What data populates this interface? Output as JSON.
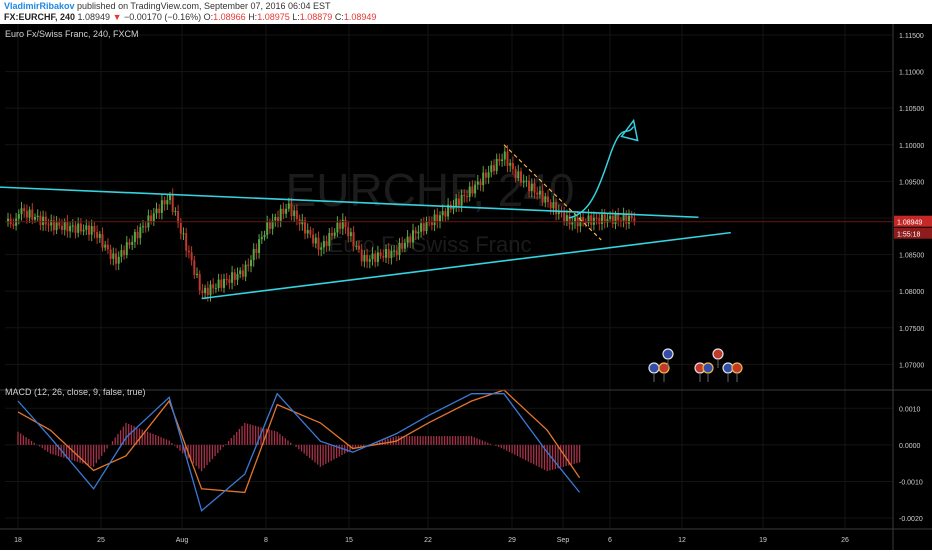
{
  "header": {
    "user": "VladimirRibakov",
    "published": " published on TradingView.com, September 07, 2016 06:04 EST",
    "symbol": "FX:EURCHF, 240",
    "last": "1.08949",
    "arrow": "▼",
    "change": "−0.00170 (−0.16%)",
    "o_label": "O:",
    "o": "1.08966",
    "h_label": "H:",
    "h": "1.08975",
    "l_label": "L:",
    "l": "1.08879",
    "c_label": "C:",
    "c": "1.08949"
  },
  "main_pane": {
    "title": "Euro Fx/Swiss Franc, 240, FXCM",
    "watermark_symbol": "EURCHF, 240",
    "watermark_desc": "Euro Fx/Swiss Franc",
    "price_tag": "1.08949",
    "countdown_tag": "1:55:18"
  },
  "macd_pane": {
    "title": "MACD (12, 26, close, 9, false, true)"
  },
  "colors": {
    "background": "#000000",
    "up_candle": "#5aa845",
    "down_candle": "#c0392b",
    "trendline": "#35d2e0",
    "dashed": "#f0b847",
    "macd_line": "#3a7ad6",
    "signal_line": "#e3752c",
    "histogram": "#a8324a",
    "price_tag": "#c62828",
    "axis_text": "#cfcfcf"
  },
  "chart_data": [
    {
      "type": "candlestick",
      "title": "Euro Fx/Swiss Franc, 240, FXCM",
      "y_axis_ticks": [
        "1.11500",
        "1.11000",
        "1.10500",
        "1.10000",
        "1.09500",
        "1.09000",
        "1.08500",
        "1.08000",
        "1.07500",
        "1.07000"
      ],
      "x_axis_ticks": [
        "18",
        "25",
        "Aug",
        "8",
        "15",
        "22",
        "29",
        "Sep",
        "6",
        "12",
        "19",
        "26"
      ],
      "ylim": [
        1.0665,
        1.1165
      ],
      "last_price": 1.08949,
      "swing_points": [
        {
          "x": "Jul 18",
          "y": 1.0915
        },
        {
          "x": "Jul 21",
          "y": 1.0895
        },
        {
          "x": "Jul 25",
          "y": 1.0885
        },
        {
          "x": "Jul 27",
          "y": 1.084
        },
        {
          "x": "Jul 29",
          "y": 1.0875
        },
        {
          "x": "Aug 1",
          "y": 1.0925
        },
        {
          "x": "Aug 3",
          "y": 1.084
        },
        {
          "x": "Aug 4",
          "y": 1.0795
        },
        {
          "x": "Aug 8",
          "y": 1.083
        },
        {
          "x": "Aug 10",
          "y": 1.089
        },
        {
          "x": "Aug 12",
          "y": 1.092
        },
        {
          "x": "Aug 15",
          "y": 1.086
        },
        {
          "x": "Aug 17",
          "y": 1.0895
        },
        {
          "x": "Aug 19",
          "y": 1.084
        },
        {
          "x": "Aug 22",
          "y": 1.085
        },
        {
          "x": "Aug 24",
          "y": 1.088
        },
        {
          "x": "Aug 26",
          "y": 1.09
        },
        {
          "x": "Aug 29",
          "y": 1.094
        },
        {
          "x": "Sep 1",
          "y": 1.099
        },
        {
          "x": "Sep 2",
          "y": 1.0965
        },
        {
          "x": "Sep 5",
          "y": 1.0925
        },
        {
          "x": "Sep 7",
          "y": 1.0895
        }
      ],
      "annotations": [
        {
          "kind": "trendline",
          "from": {
            "x": "Jul 15",
            "y": 1.0943
          },
          "to": {
            "x": "Sep 19",
            "y": 1.0901
          }
        },
        {
          "kind": "trendline",
          "from": {
            "x": "Aug 4",
            "y": 1.079
          },
          "to": {
            "x": "Sep 22",
            "y": 1.088
          }
        },
        {
          "kind": "dashed-line",
          "from": {
            "x": "Sep 1",
            "y": 1.1
          },
          "to": {
            "x": "Sep 10",
            "y": 1.087
          }
        },
        {
          "kind": "projection-arrow",
          "from": {
            "x": "Sep 7",
            "y": 1.09
          },
          "to": {
            "x": "Sep 13",
            "y": 1.1025
          }
        }
      ]
    },
    {
      "type": "line",
      "title": "MACD (12, 26, close, 9, false, true)",
      "y_axis_ticks": [
        "0.0010",
        "0.0000",
        "-0.0010",
        "-0.0020"
      ],
      "ylim": [
        -0.0023,
        0.0015
      ],
      "series": [
        {
          "name": "MACD",
          "x": [
            "Jul 18",
            "Jul 21",
            "Jul 25",
            "Jul 28",
            "Aug 1",
            "Aug 4",
            "Aug 8",
            "Aug 11",
            "Aug 15",
            "Aug 18",
            "Aug 22",
            "Aug 25",
            "Aug 29",
            "Sep 1",
            "Sep 5",
            "Sep 8"
          ],
          "values": [
            0.0012,
            0.0002,
            -0.0012,
            0.0002,
            0.0013,
            -0.0018,
            -0.0008,
            0.0014,
            0.0001,
            -0.0002,
            0.0003,
            0.0008,
            0.0014,
            0.0014,
            -0.0002,
            -0.0013
          ]
        },
        {
          "name": "Signal",
          "x": [
            "Jul 18",
            "Jul 21",
            "Jul 25",
            "Jul 28",
            "Aug 1",
            "Aug 4",
            "Aug 8",
            "Aug 11",
            "Aug 15",
            "Aug 18",
            "Aug 22",
            "Aug 25",
            "Aug 29",
            "Sep 1",
            "Sep 5",
            "Sep 8"
          ],
          "values": [
            0.0009,
            0.0004,
            -0.0007,
            -0.0003,
            0.0012,
            -0.0012,
            -0.0013,
            0.0011,
            0.0006,
            -0.0001,
            0.0001,
            0.0006,
            0.0012,
            0.0015,
            0.0004,
            -0.0009
          ]
        }
      ]
    }
  ]
}
